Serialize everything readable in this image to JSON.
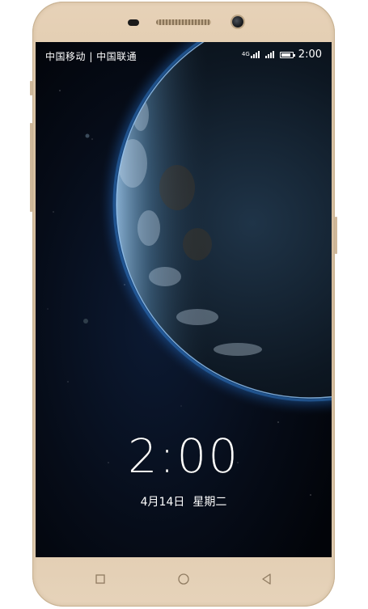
{
  "status_bar": {
    "carriers": "中国移动 | 中国联通",
    "network": "4G",
    "signal_1_level": 4,
    "signal_2_level": 4,
    "battery_level": 0.85,
    "time": "2:00"
  },
  "lockscreen": {
    "time": "2:00",
    "date": "4月14日",
    "weekday": "星期二"
  },
  "wallpaper": {
    "subject": "earth-from-space",
    "atmosphere_color": "#3a8fe0",
    "space_color": "#03060c"
  },
  "nav_bar": {
    "recent_icon": "square-icon",
    "home_icon": "circle-icon",
    "back_icon": "triangle-left-icon"
  },
  "device": {
    "body_color": "#dfc9ac"
  }
}
